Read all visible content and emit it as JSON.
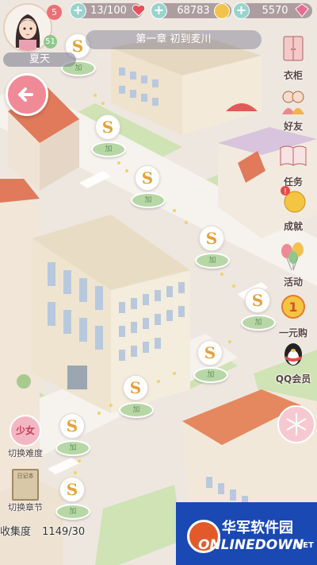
{
  "player": {
    "name": "夏天",
    "level": "51",
    "badge": "5"
  },
  "resources": {
    "stamina": "13/100",
    "coins": "68783",
    "gems": "5570"
  },
  "chapter_title": "第一章 初到麦川",
  "side_menu": [
    {
      "label": "衣柜",
      "icon": "wardrobe-icon"
    },
    {
      "label": "好友",
      "icon": "friends-icon"
    },
    {
      "label": "任务",
      "icon": "book-icon"
    },
    {
      "label": "成就",
      "icon": "achievement-icon"
    },
    {
      "label": "活动",
      "icon": "balloons-icon"
    },
    {
      "label": "一元购",
      "icon": "one-yuan-icon"
    },
    {
      "label": "QQ会员",
      "icon": "qq-penguin-icon"
    }
  ],
  "left_menu": {
    "difficulty_badge": "少女",
    "difficulty_label": "切换难度",
    "chapter_label": "切换章节",
    "chapter_book_text": "日记本"
  },
  "collection": {
    "label": "收集度",
    "value": "1149/30"
  },
  "level_node_letter": "S",
  "level_node_coin": "加",
  "watermark": {
    "title": "华军软件园",
    "subtitle": "ONLINEDOWN",
    "suffix": ".NET"
  },
  "colors": {
    "accent_pink": "#f08a96",
    "coin_green": "#b7d8a6",
    "logo_blue": "#1a49b4"
  }
}
